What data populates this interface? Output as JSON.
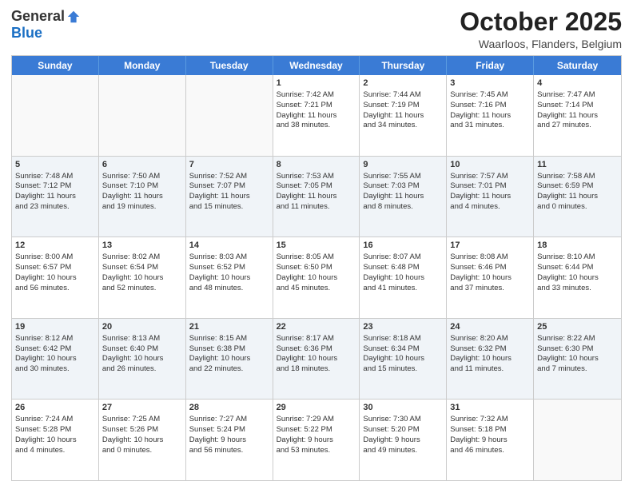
{
  "logo": {
    "general": "General",
    "blue": "Blue"
  },
  "header": {
    "month": "October 2025",
    "location": "Waarloos, Flanders, Belgium"
  },
  "weekdays": [
    "Sunday",
    "Monday",
    "Tuesday",
    "Wednesday",
    "Thursday",
    "Friday",
    "Saturday"
  ],
  "rows": [
    [
      {
        "day": "",
        "info": "",
        "empty": true
      },
      {
        "day": "",
        "info": "",
        "empty": true
      },
      {
        "day": "",
        "info": "",
        "empty": true
      },
      {
        "day": "1",
        "info": "Sunrise: 7:42 AM\nSunset: 7:21 PM\nDaylight: 11 hours\nand 38 minutes.",
        "empty": false
      },
      {
        "day": "2",
        "info": "Sunrise: 7:44 AM\nSunset: 7:19 PM\nDaylight: 11 hours\nand 34 minutes.",
        "empty": false
      },
      {
        "day": "3",
        "info": "Sunrise: 7:45 AM\nSunset: 7:16 PM\nDaylight: 11 hours\nand 31 minutes.",
        "empty": false
      },
      {
        "day": "4",
        "info": "Sunrise: 7:47 AM\nSunset: 7:14 PM\nDaylight: 11 hours\nand 27 minutes.",
        "empty": false
      }
    ],
    [
      {
        "day": "5",
        "info": "Sunrise: 7:48 AM\nSunset: 7:12 PM\nDaylight: 11 hours\nand 23 minutes.",
        "empty": false
      },
      {
        "day": "6",
        "info": "Sunrise: 7:50 AM\nSunset: 7:10 PM\nDaylight: 11 hours\nand 19 minutes.",
        "empty": false
      },
      {
        "day": "7",
        "info": "Sunrise: 7:52 AM\nSunset: 7:07 PM\nDaylight: 11 hours\nand 15 minutes.",
        "empty": false
      },
      {
        "day": "8",
        "info": "Sunrise: 7:53 AM\nSunset: 7:05 PM\nDaylight: 11 hours\nand 11 minutes.",
        "empty": false
      },
      {
        "day": "9",
        "info": "Sunrise: 7:55 AM\nSunset: 7:03 PM\nDaylight: 11 hours\nand 8 minutes.",
        "empty": false
      },
      {
        "day": "10",
        "info": "Sunrise: 7:57 AM\nSunset: 7:01 PM\nDaylight: 11 hours\nand 4 minutes.",
        "empty": false
      },
      {
        "day": "11",
        "info": "Sunrise: 7:58 AM\nSunset: 6:59 PM\nDaylight: 11 hours\nand 0 minutes.",
        "empty": false
      }
    ],
    [
      {
        "day": "12",
        "info": "Sunrise: 8:00 AM\nSunset: 6:57 PM\nDaylight: 10 hours\nand 56 minutes.",
        "empty": false
      },
      {
        "day": "13",
        "info": "Sunrise: 8:02 AM\nSunset: 6:54 PM\nDaylight: 10 hours\nand 52 minutes.",
        "empty": false
      },
      {
        "day": "14",
        "info": "Sunrise: 8:03 AM\nSunset: 6:52 PM\nDaylight: 10 hours\nand 48 minutes.",
        "empty": false
      },
      {
        "day": "15",
        "info": "Sunrise: 8:05 AM\nSunset: 6:50 PM\nDaylight: 10 hours\nand 45 minutes.",
        "empty": false
      },
      {
        "day": "16",
        "info": "Sunrise: 8:07 AM\nSunset: 6:48 PM\nDaylight: 10 hours\nand 41 minutes.",
        "empty": false
      },
      {
        "day": "17",
        "info": "Sunrise: 8:08 AM\nSunset: 6:46 PM\nDaylight: 10 hours\nand 37 minutes.",
        "empty": false
      },
      {
        "day": "18",
        "info": "Sunrise: 8:10 AM\nSunset: 6:44 PM\nDaylight: 10 hours\nand 33 minutes.",
        "empty": false
      }
    ],
    [
      {
        "day": "19",
        "info": "Sunrise: 8:12 AM\nSunset: 6:42 PM\nDaylight: 10 hours\nand 30 minutes.",
        "empty": false
      },
      {
        "day": "20",
        "info": "Sunrise: 8:13 AM\nSunset: 6:40 PM\nDaylight: 10 hours\nand 26 minutes.",
        "empty": false
      },
      {
        "day": "21",
        "info": "Sunrise: 8:15 AM\nSunset: 6:38 PM\nDaylight: 10 hours\nand 22 minutes.",
        "empty": false
      },
      {
        "day": "22",
        "info": "Sunrise: 8:17 AM\nSunset: 6:36 PM\nDaylight: 10 hours\nand 18 minutes.",
        "empty": false
      },
      {
        "day": "23",
        "info": "Sunrise: 8:18 AM\nSunset: 6:34 PM\nDaylight: 10 hours\nand 15 minutes.",
        "empty": false
      },
      {
        "day": "24",
        "info": "Sunrise: 8:20 AM\nSunset: 6:32 PM\nDaylight: 10 hours\nand 11 minutes.",
        "empty": false
      },
      {
        "day": "25",
        "info": "Sunrise: 8:22 AM\nSunset: 6:30 PM\nDaylight: 10 hours\nand 7 minutes.",
        "empty": false
      }
    ],
    [
      {
        "day": "26",
        "info": "Sunrise: 7:24 AM\nSunset: 5:28 PM\nDaylight: 10 hours\nand 4 minutes.",
        "empty": false
      },
      {
        "day": "27",
        "info": "Sunrise: 7:25 AM\nSunset: 5:26 PM\nDaylight: 10 hours\nand 0 minutes.",
        "empty": false
      },
      {
        "day": "28",
        "info": "Sunrise: 7:27 AM\nSunset: 5:24 PM\nDaylight: 9 hours\nand 56 minutes.",
        "empty": false
      },
      {
        "day": "29",
        "info": "Sunrise: 7:29 AM\nSunset: 5:22 PM\nDaylight: 9 hours\nand 53 minutes.",
        "empty": false
      },
      {
        "day": "30",
        "info": "Sunrise: 7:30 AM\nSunset: 5:20 PM\nDaylight: 9 hours\nand 49 minutes.",
        "empty": false
      },
      {
        "day": "31",
        "info": "Sunrise: 7:32 AM\nSunset: 5:18 PM\nDaylight: 9 hours\nand 46 minutes.",
        "empty": false
      },
      {
        "day": "",
        "info": "",
        "empty": true
      }
    ]
  ]
}
